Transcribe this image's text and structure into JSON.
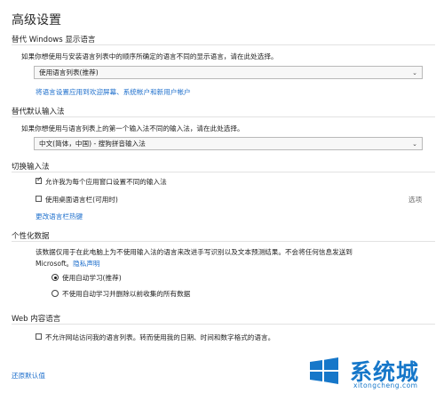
{
  "page_title": "高级设置",
  "display_language": {
    "heading": "替代 Windows 显示语言",
    "description": "如果你想使用与安装语言列表中的顺序所确定的语言不同的显示语言，请在此处选择。",
    "selected": "使用语言列表(推荐)",
    "link": "将语言设置应用到欢迎屏幕、系统帐户和新用户帐户"
  },
  "input_method": {
    "heading": "替代默认输入法",
    "description": "如果你想使用与语言列表上的第一个输入法不同的输入法，请在此处选择。",
    "selected": "中文(简体，中国) - 搜狗拼音输入法"
  },
  "switch_input": {
    "heading": "切换输入法",
    "per_app_label": "允许我为每个应用窗口设置不同的输入法",
    "per_app_checked": true,
    "desktop_bar_label": "使用桌面语言栏(可用时)",
    "desktop_bar_checked": false,
    "options_link": "选项",
    "hotkeys_link": "更改语言栏热键"
  },
  "personalization": {
    "heading": "个性化数据",
    "description_line1": "该数据仅用于在此电脑上为不使用输入法的语言来改进手写识别以及文本预测结果。不会将任何信息发送到",
    "description_line2": "Microsoft。",
    "privacy_link": "隐私声明",
    "option_auto": "使用自动学习(推荐)",
    "option_off": "不使用自动学习并删除以前收集的所有数据",
    "selected_option": "auto"
  },
  "web_language": {
    "heading": "Web 内容语言",
    "checkbox_label": "不允许网站访问我的语言列表。转而使用我的日期、时间和数字格式的语言。",
    "checked": false
  },
  "restore_defaults": "还原默认值",
  "watermark": {
    "brand": "系统城",
    "url": "xitongcheng.com",
    "color": "#1677c9"
  }
}
